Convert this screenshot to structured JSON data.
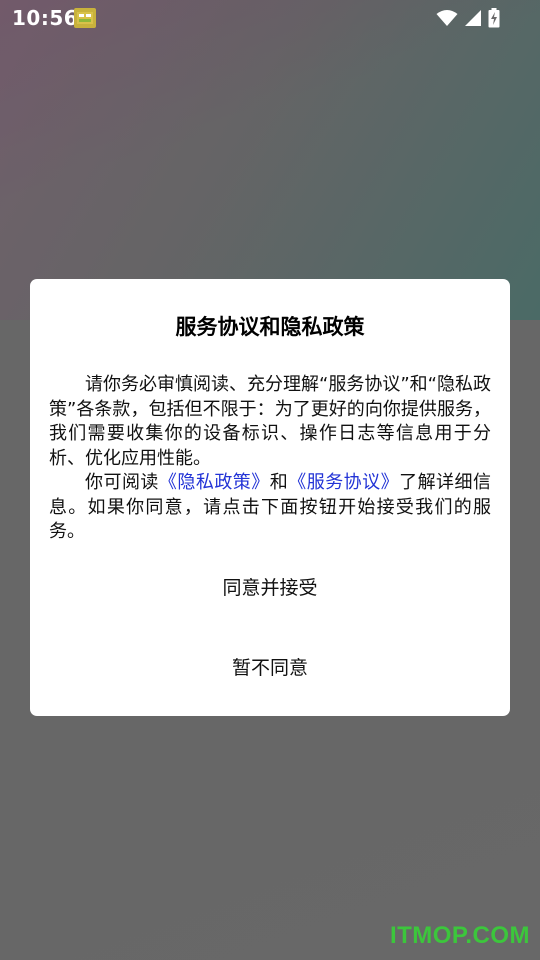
{
  "status_bar": {
    "time": "10:56",
    "icons": [
      "app-notification-icon",
      "wifi-icon",
      "cell-signal-icon",
      "battery-charging-icon"
    ]
  },
  "dialog": {
    "title": "服务协议和隐私政策",
    "paragraph1": "请你务必审慎阅读、充分理解“服务协议”和“隐私政策”各条款，包括但不限于：为了更好的向你提供服务，我们需要收集你的设备标识、操作日志等信息用于分析、优化应用性能。",
    "paragraph2": {
      "prefix": "你可阅读",
      "privacy_link": "《隐私政策》",
      "and": "和",
      "service_link": "《服务协议》",
      "suffix": "了解详细信息。如果你同意，请点击下面按钮开始接受我们的服务。"
    },
    "agree_label": "同意并接受",
    "decline_label": "暂不同意",
    "link_color": "#2233d6"
  },
  "watermark": "ITMOP.COM"
}
